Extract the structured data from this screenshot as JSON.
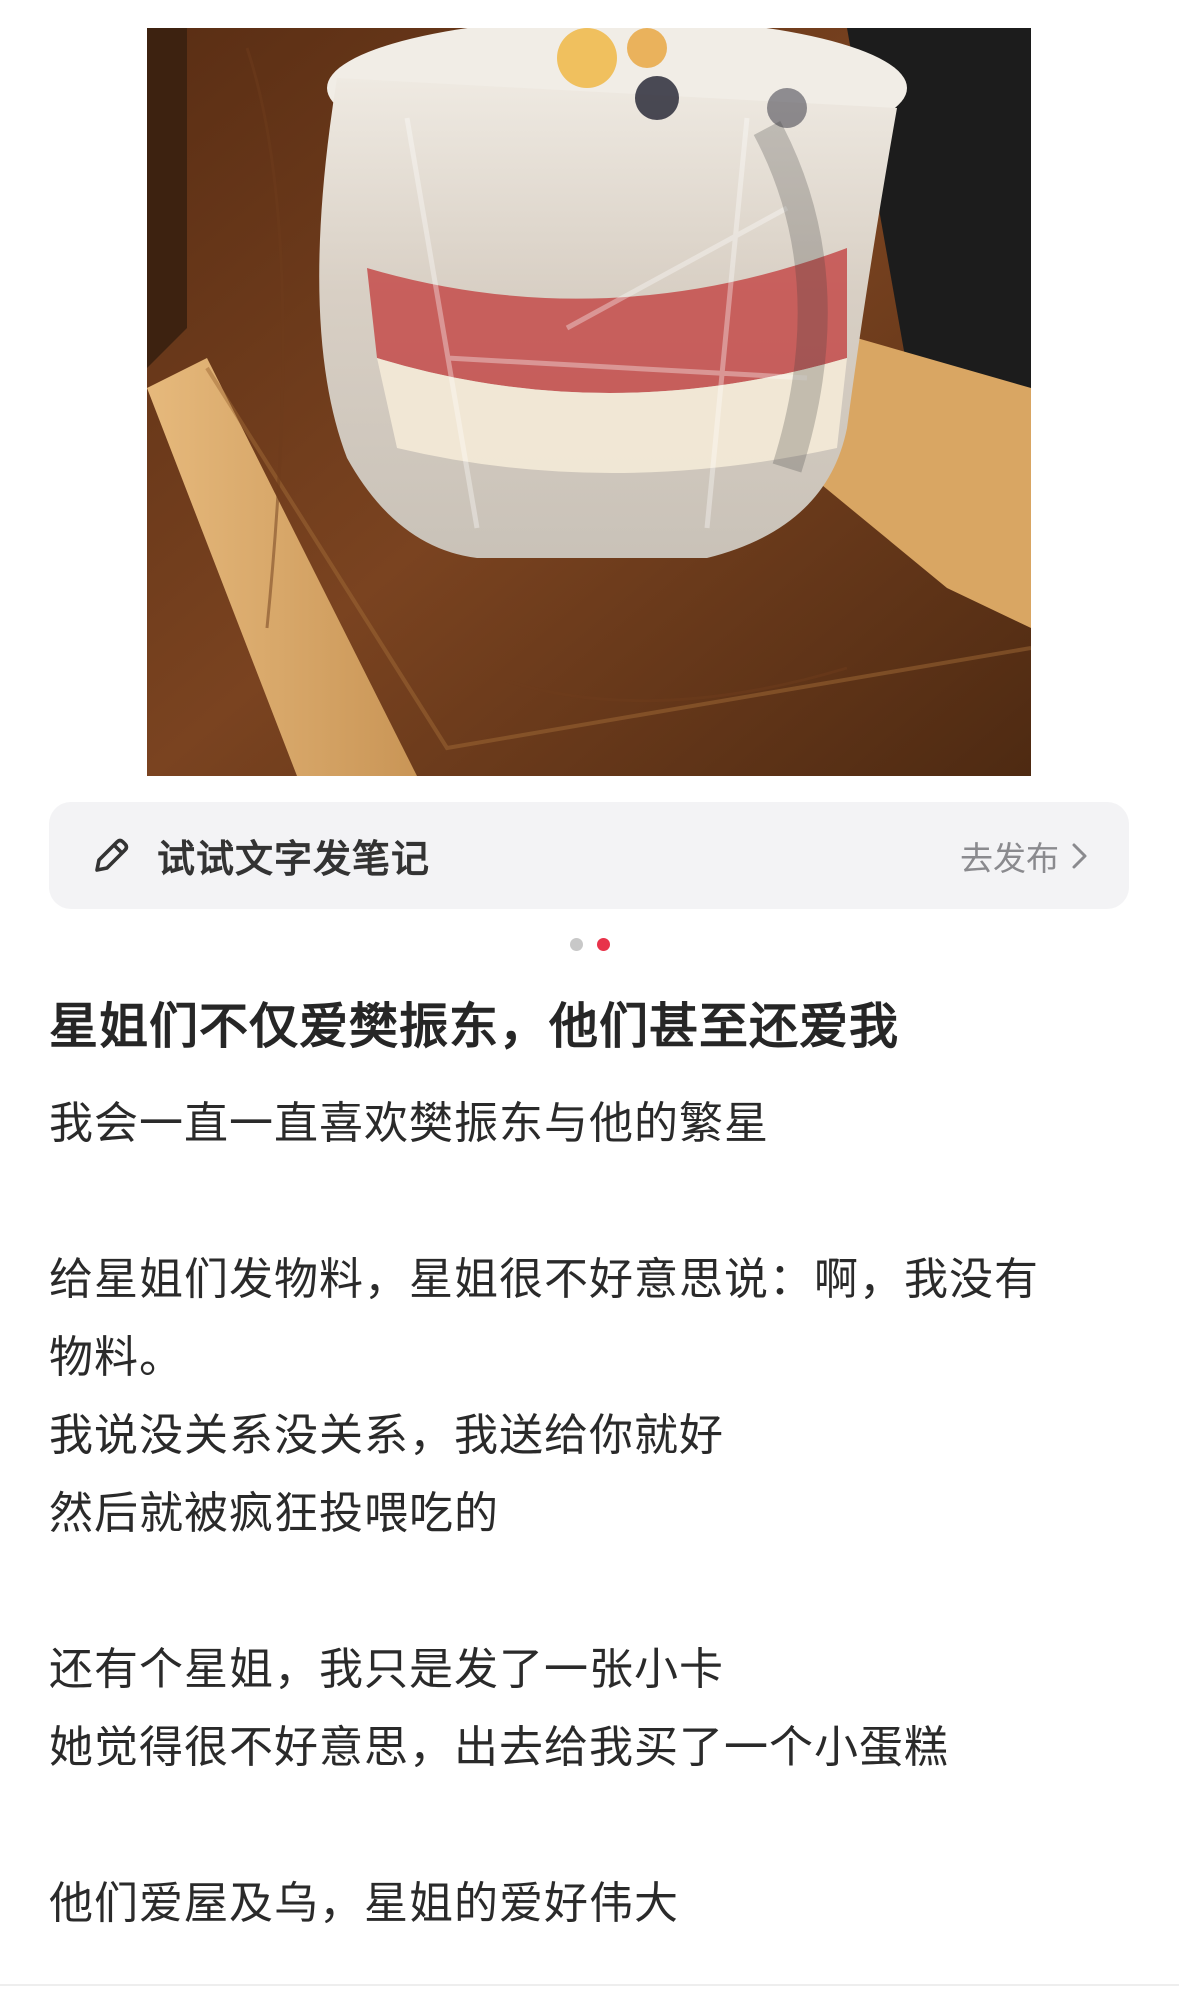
{
  "post": {
    "image_alt_icon": "cake-photo",
    "publish_prompt": "试试文字发笔记",
    "publish_action": "去发布",
    "carousel": {
      "count": 2,
      "active_index": 1
    },
    "title": "星姐们不仅爱樊振东，他们甚至还爱我",
    "body_lines": [
      "我会一直一直喜欢樊振东与他的繁星",
      "",
      "给星姐们发物料，星姐很不好意思说：啊，我没有",
      "物料。",
      "我说没关系没关系，我送给你就好",
      "然后就被疯狂投喂吃的",
      "",
      "还有个星姐，我只是发了一张小卡",
      "她觉得很不好意思，出去给我买了一个小蛋糕",
      "",
      "他们爱屋及乌，星姐的爱好伟大"
    ]
  },
  "colors": {
    "accent": "#e8334a",
    "bar_bg": "#f3f3f5",
    "muted": "#8a8a8e"
  }
}
